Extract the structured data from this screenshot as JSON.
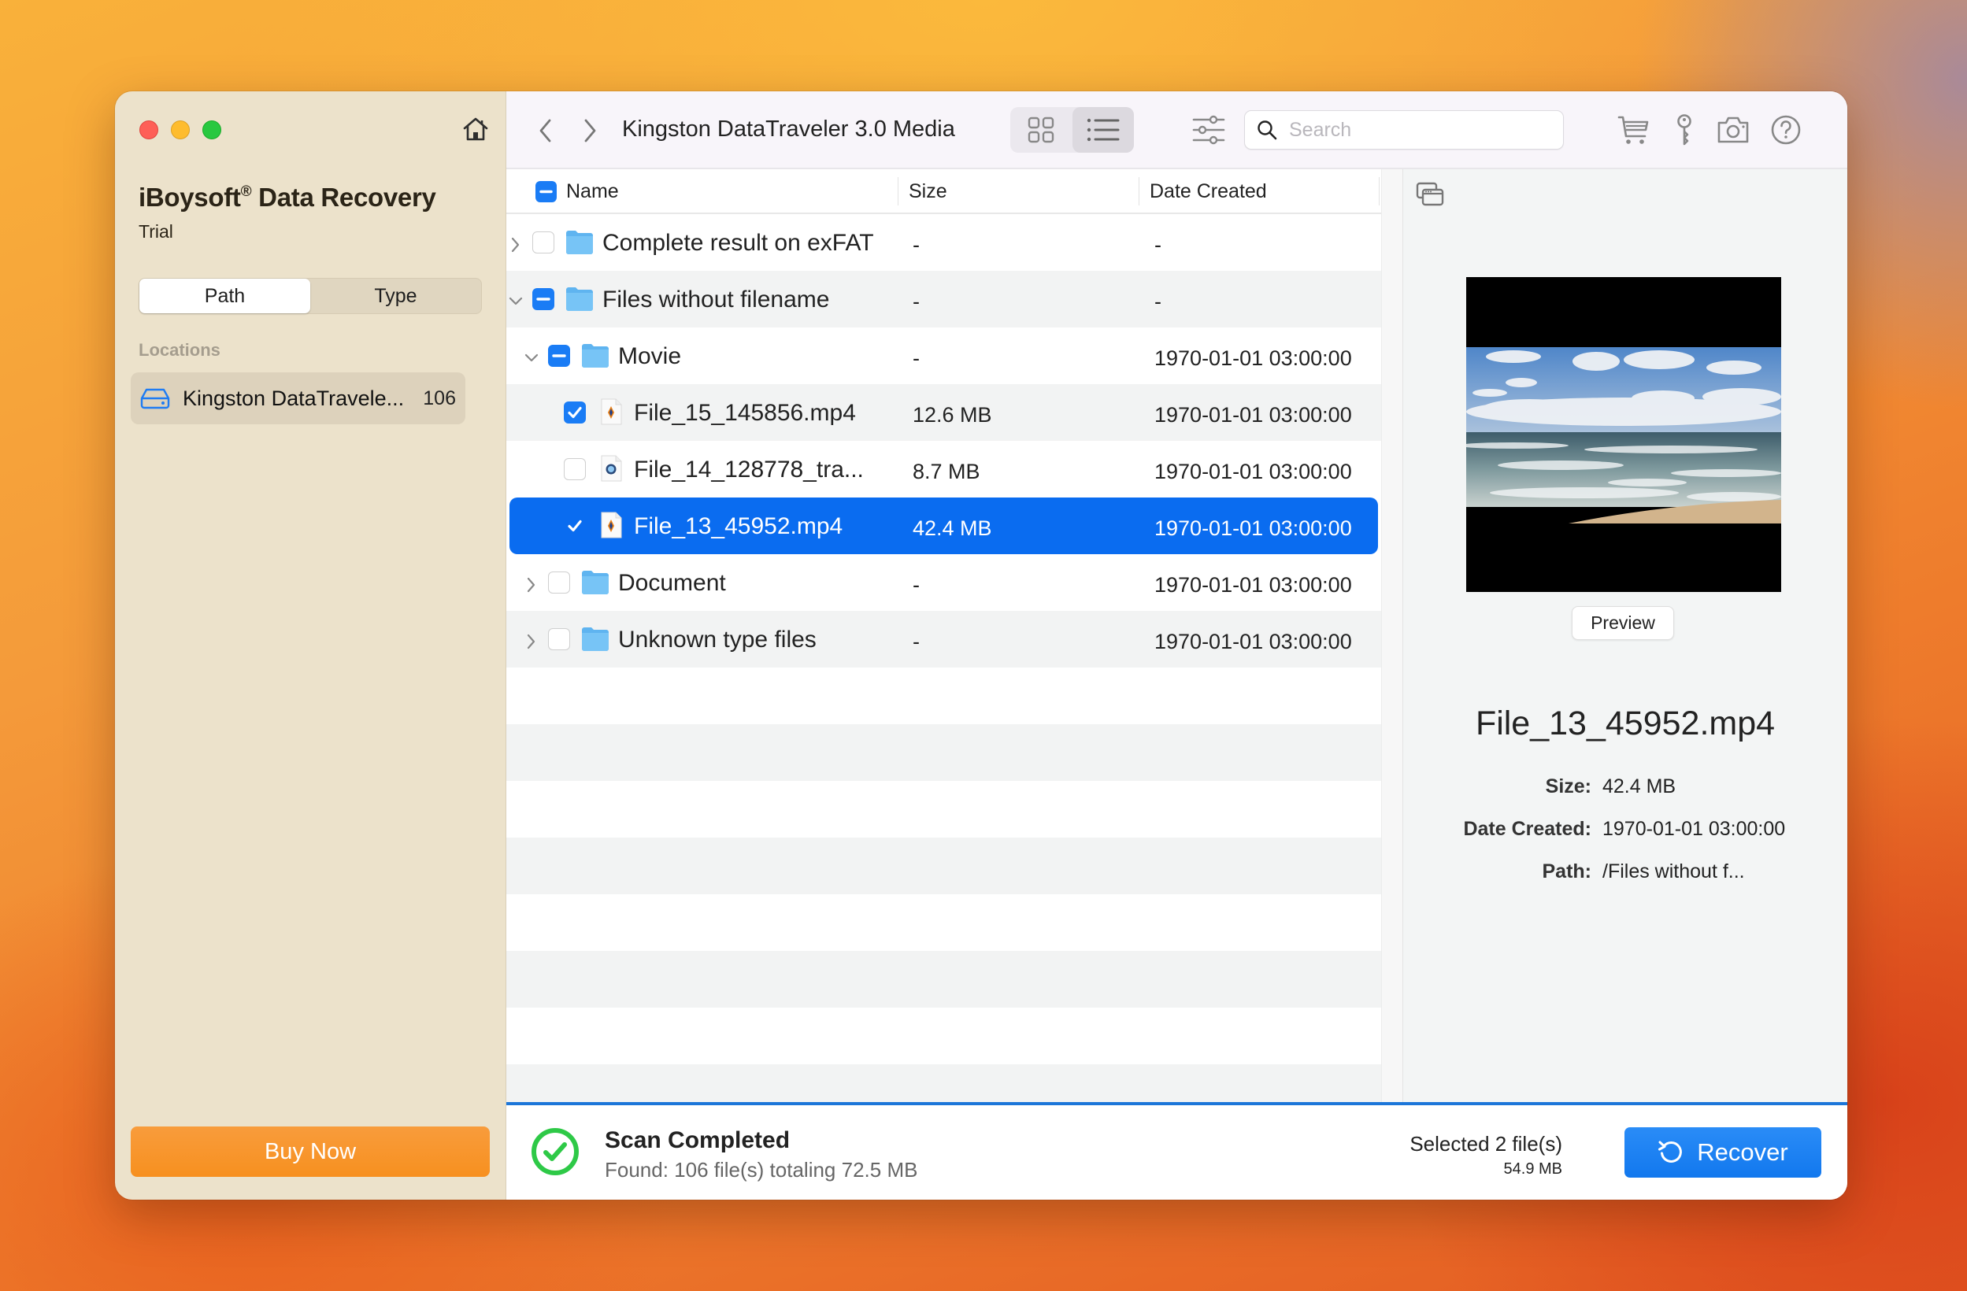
{
  "sidebar": {
    "app_name": "iBoysoft",
    "app_reg": "®",
    "app_suffix": " Data Recovery",
    "edition": "Trial",
    "segments": [
      {
        "label": "Path",
        "active": true
      },
      {
        "label": "Type",
        "active": false
      }
    ],
    "locations_label": "Locations",
    "locations": [
      {
        "name": "Kingston DataTravele...",
        "count": "106",
        "icon": "drive-icon"
      }
    ],
    "buy_label": "Buy Now"
  },
  "toolbar": {
    "title": "Kingston DataTraveler 3.0 Media",
    "search_placeholder": "Search",
    "search_value": "",
    "view_mode": "list",
    "icons": [
      "back-icon",
      "forward-icon",
      "grid-view-icon",
      "list-view-icon",
      "filter-sliders-icon",
      "search-icon",
      "cart-icon",
      "key-icon",
      "camera-icon",
      "help-icon"
    ]
  },
  "list": {
    "columns": {
      "name": "Name",
      "size": "Size",
      "date": "Date Created"
    },
    "header_checkbox": "mixed",
    "rows": [
      {
        "level": 0,
        "expander": "collapsed",
        "check": "off",
        "type": "folder",
        "name": "Complete result on exFAT",
        "size": "-",
        "date": "-",
        "alt": false,
        "selected": false
      },
      {
        "level": 0,
        "expander": "expanded",
        "check": "mixed",
        "type": "folder",
        "name": "Files without filename",
        "size": "-",
        "date": "-",
        "alt": true,
        "selected": false
      },
      {
        "level": 1,
        "expander": "expanded",
        "check": "mixed",
        "type": "folder",
        "name": "Movie",
        "size": "-",
        "date": "1970-01-01 03:00:00",
        "alt": false,
        "selected": false
      },
      {
        "level": 2,
        "expander": "none",
        "check": "on",
        "type": "video",
        "name": "File_15_145856.mp4",
        "size": "12.6 MB",
        "date": "1970-01-01 03:00:00",
        "alt": true,
        "selected": false
      },
      {
        "level": 2,
        "expander": "none",
        "check": "off",
        "type": "quicktime",
        "name": "File_14_128778_tra...",
        "size": "8.7 MB",
        "date": "1970-01-01 03:00:00",
        "alt": false,
        "selected": false
      },
      {
        "level": 2,
        "expander": "none",
        "check": "on",
        "type": "video",
        "name": "File_13_45952.mp4",
        "size": "42.4 MB",
        "date": "1970-01-01 03:00:00",
        "alt": false,
        "selected": true
      },
      {
        "level": 1,
        "expander": "collapsed",
        "check": "off",
        "type": "folder",
        "name": "Document",
        "size": "-",
        "date": "1970-01-01 03:00:00",
        "alt": false,
        "selected": false
      },
      {
        "level": 1,
        "expander": "collapsed",
        "check": "off",
        "type": "folder",
        "name": "Unknown type files",
        "size": "-",
        "date": "1970-01-01 03:00:00",
        "alt": true,
        "selected": false
      }
    ]
  },
  "preview": {
    "button_label": "Preview",
    "file_name": "File_13_45952.mp4",
    "meta": [
      {
        "key": "Size:",
        "value": "42.4 MB"
      },
      {
        "key": "Date Created:",
        "value": "1970-01-01 03:00:00"
      },
      {
        "key": "Path:",
        "value": "/Files without f..."
      }
    ]
  },
  "footer": {
    "status_title": "Scan Completed",
    "status_detail": "Found: 106 file(s) totaling 72.5 MB",
    "selected_text": "Selected 2 file(s)",
    "selected_size": "54.9 MB",
    "recover_label": "Recover"
  },
  "colors": {
    "accent": "#0a6cf0",
    "buy": "#f7901f",
    "success": "#2ec947",
    "sidebar_bg": "#ece2cb"
  }
}
